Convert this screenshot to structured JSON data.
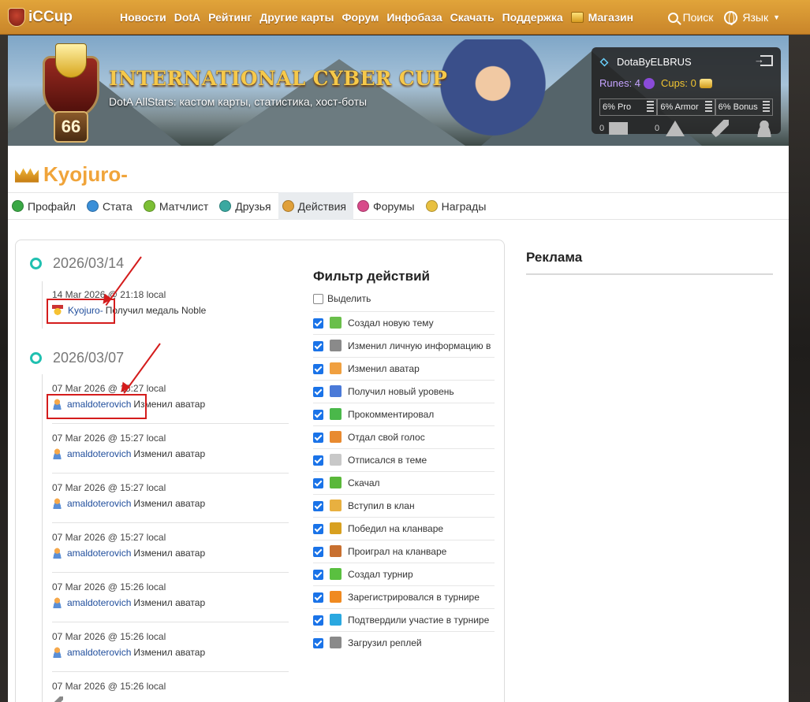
{
  "nav": {
    "logo_text": "iCCup",
    "items": [
      "Новости",
      "DotA",
      "Рейтинг",
      "Другие карты",
      "Форум",
      "Инфобаза",
      "Скачать",
      "Поддержка",
      "Магазин"
    ],
    "search_label": "Поиск",
    "language_label": "Язык"
  },
  "banner": {
    "title": "INTERNATIONAL CYBER CUP",
    "subtitle": "DotA AllStars: кастом карты, статистика, хост-боты",
    "level": "66"
  },
  "userbox": {
    "username": "DotaByELBRUS",
    "runes_label": "Runes: 4",
    "cups_label": "Cups: 0",
    "bonuses": [
      "6% Pro",
      "6% Armor",
      "6% Bonus"
    ],
    "messages_count": "0",
    "warnings_count": "0"
  },
  "profile": {
    "name": "Kyojuro-"
  },
  "tabs": [
    {
      "label": "Профайл",
      "color": "#3aa845"
    },
    {
      "label": "Стата",
      "color": "#3a8fd8"
    },
    {
      "label": "Матчлист",
      "color": "#7cbf35"
    },
    {
      "label": "Друзья",
      "color": "#3aa8a0"
    },
    {
      "label": "Действия",
      "color": "#e0a03a"
    },
    {
      "label": "Форумы",
      "color": "#d84a8a"
    },
    {
      "label": "Награды",
      "color": "#e8c040"
    }
  ],
  "timeline": {
    "groups": [
      {
        "date": "2026/03/14",
        "entries": [
          {
            "time": "14 Mar 2026 @ 21:18 local",
            "user": "Kyojuro-",
            "action": "Получил медаль  Noble",
            "icon": "medal-icon"
          }
        ]
      },
      {
        "date": "2026/03/07",
        "entries": [
          {
            "time": "07 Mar 2026 @ 15:27 local",
            "user": "amaldoterovich",
            "action": "Изменил аватар",
            "icon": "avatar-icon"
          },
          {
            "time": "07 Mar 2026 @ 15:27 local",
            "user": "amaldoterovich",
            "action": "Изменил аватар",
            "icon": "avatar-icon"
          },
          {
            "time": "07 Mar 2026 @ 15:27 local",
            "user": "amaldoterovich",
            "action": "Изменил аватар",
            "icon": "avatar-icon"
          },
          {
            "time": "07 Mar 2026 @ 15:27 local",
            "user": "amaldoterovich",
            "action": "Изменил аватар",
            "icon": "avatar-icon"
          },
          {
            "time": "07 Mar 2026 @ 15:26 local",
            "user": "amaldoterovich",
            "action": "Изменил аватар",
            "icon": "avatar-icon"
          },
          {
            "time": "07 Mar 2026 @ 15:26 local",
            "user": "amaldoterovich",
            "action": "Изменил аватар",
            "icon": "avatar-icon"
          },
          {
            "time": "07 Mar 2026 @ 15:26 local",
            "user": "",
            "action": "",
            "icon": "wrench-icon"
          }
        ]
      }
    ]
  },
  "filter": {
    "title": "Фильтр действий",
    "select_all_label": "Выделить",
    "options": [
      {
        "label": "Создал новую тему",
        "checked": true,
        "color": "#6abf4b"
      },
      {
        "label": "Изменил личную информацию в",
        "checked": true,
        "color": "#8a8a8a"
      },
      {
        "label": "Изменил аватар",
        "checked": true,
        "color": "#f0a040"
      },
      {
        "label": "Получил новый уровень",
        "checked": true,
        "color": "#4a7ad8"
      },
      {
        "label": "Прокомментировал",
        "checked": true,
        "color": "#4ab84a"
      },
      {
        "label": "Отдал свой голос",
        "checked": true,
        "color": "#e88a30"
      },
      {
        "label": "Отписался в теме",
        "checked": true,
        "color": "#c8c8c8"
      },
      {
        "label": "Скачал",
        "checked": true,
        "color": "#5ab83a"
      },
      {
        "label": "Вступил в клан",
        "checked": true,
        "color": "#e8b040"
      },
      {
        "label": "Победил на кланваре",
        "checked": true,
        "color": "#d8a020"
      },
      {
        "label": "Проиграл на кланваре",
        "checked": true,
        "color": "#c87030"
      },
      {
        "label": "Создал турнир",
        "checked": true,
        "color": "#5ac040"
      },
      {
        "label": "Зарегистрировался в турнире",
        "checked": true,
        "color": "#f08a20"
      },
      {
        "label": "Подтвердили участие в турнире",
        "checked": true,
        "color": "#2aa8e0"
      },
      {
        "label": "Загрузил реплей",
        "checked": true,
        "color": "#8a8a8a"
      }
    ]
  },
  "ad": {
    "title": "Реклама"
  },
  "colors": {
    "nav_bg": "#d9952f",
    "profile_name": "#f0a43a",
    "link": "#1f4d9c",
    "timeline_dot": "#20c0b0",
    "checkbox": "#1a73e8",
    "annotation": "#d41c1c"
  }
}
